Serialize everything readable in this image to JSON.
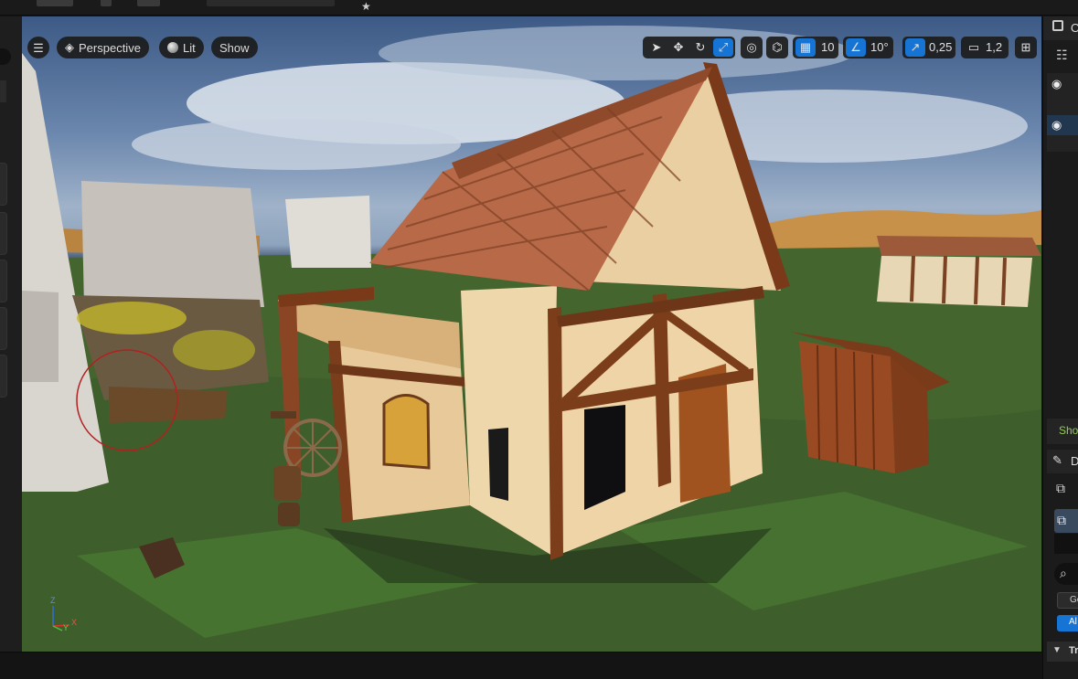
{
  "viewport": {
    "menu_icon": "hamburger-icon",
    "perspective_label": "Perspective",
    "lit_label": "Lit",
    "show_label": "Show",
    "grid_snap_value": "10",
    "rotation_snap_value": "10°",
    "scale_snap_value": "0,25",
    "camera_speed_value": "1,2",
    "axis": {
      "z": "Z",
      "y": "Y",
      "x": "X"
    }
  },
  "outliner": {
    "tab_label": "O",
    "show_label": "Sho",
    "details_label": "D",
    "general_label": "Ge",
    "all_label": "Al",
    "transform_label": "Tra"
  },
  "colors": {
    "accent": "#1574d4",
    "panel_bg": "#1b1b1b",
    "toolbar_bg": "#1c1c1c"
  }
}
